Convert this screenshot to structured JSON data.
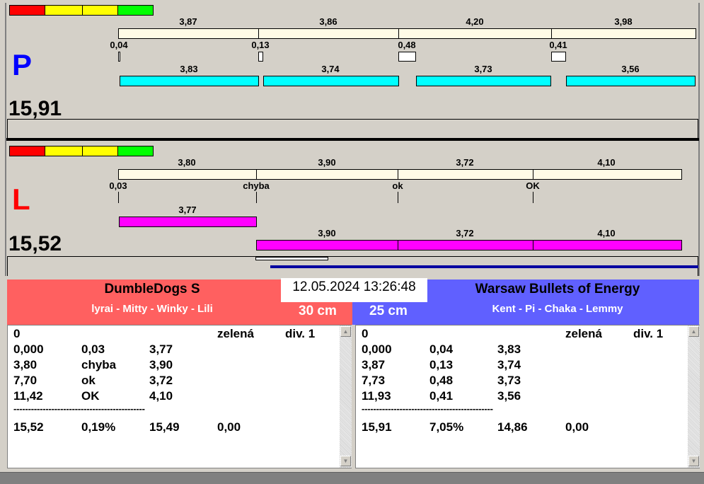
{
  "colors": {
    "red": "#ff0000",
    "yellow": "#ffff00",
    "green": "#00ff00",
    "team_left": "#ff6060",
    "team_right": "#6060ff",
    "cyan": "#00ffff",
    "magenta": "#ff00ff"
  },
  "panel_p": {
    "letter": "P",
    "total": "15,91",
    "top_labels": [
      "3,87",
      "3,86",
      "4,20",
      "3,98"
    ],
    "gap_labels": [
      "0,04",
      "0,13",
      "0,48",
      "0,41"
    ],
    "bar_labels": [
      "3,83",
      "3,74",
      "3,73",
      "3,56"
    ]
  },
  "panel_l": {
    "letter": "L",
    "total": "15,52",
    "top_labels": [
      "3,80",
      "3,90",
      "3,72",
      "4,10"
    ],
    "gap_labels": [
      "0,03",
      "chyba",
      "ok",
      "OK"
    ],
    "bar1_label": "3,77",
    "bar2_labels": [
      "3,90",
      "3,72",
      "4,10"
    ]
  },
  "datetime": "12.05.2024 13:26:48",
  "left_team": {
    "name": "DumbleDogs S",
    "members": "lyrai - Mitty - Winky - Lili",
    "distance": "30 cm",
    "header": [
      "0",
      "zelená",
      "div. 1"
    ],
    "rows": [
      [
        "0,000",
        "0,03",
        "3,77"
      ],
      [
        "3,80",
        "chyba",
        "3,90"
      ],
      [
        "7,70",
        "ok",
        "3,72"
      ],
      [
        "11,42",
        "OK",
        "4,10"
      ]
    ],
    "separator": "---------------------------------------------",
    "total": [
      "15,52",
      "0,19%",
      "15,49",
      "0,00"
    ]
  },
  "right_team": {
    "name": "Warsaw Bullets of Energy",
    "members": "Kent - Pi - Chaka - Lemmy",
    "distance": "25 cm",
    "header": [
      "0",
      "zelená",
      "div. 1"
    ],
    "rows": [
      [
        "0,000",
        "0,04",
        "3,83"
      ],
      [
        "3,87",
        "0,13",
        "3,74"
      ],
      [
        "7,73",
        "0,48",
        "3,73"
      ],
      [
        "11,93",
        "0,41",
        "3,56"
      ]
    ],
    "separator": "---------------------------------------------",
    "total": [
      "15,91",
      "7,05%",
      "14,86",
      "0,00"
    ]
  }
}
